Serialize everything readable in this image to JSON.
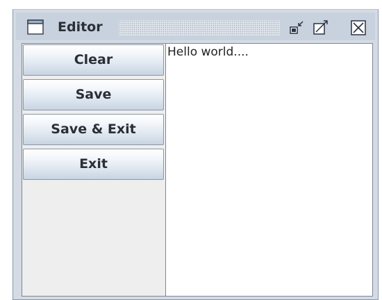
{
  "window": {
    "title": "Editor",
    "title_icon": "window-icon",
    "controls": {
      "minimize_icon": "minimize-icon",
      "maximize_icon": "maximize-icon",
      "close_icon": "close-icon"
    }
  },
  "toolbar": {
    "buttons": [
      {
        "label": "Clear"
      },
      {
        "label": "Save"
      },
      {
        "label": "Save & Exit"
      },
      {
        "label": "Exit"
      }
    ]
  },
  "editor": {
    "text": "Hello world...."
  },
  "colors": {
    "titlebar": "#c8d2de",
    "frame": "#d4dbe5",
    "button_top": "#ffffff",
    "button_bottom": "#c8d4e2",
    "panel": "#eeeeee",
    "editor_bg": "#ffffff"
  }
}
